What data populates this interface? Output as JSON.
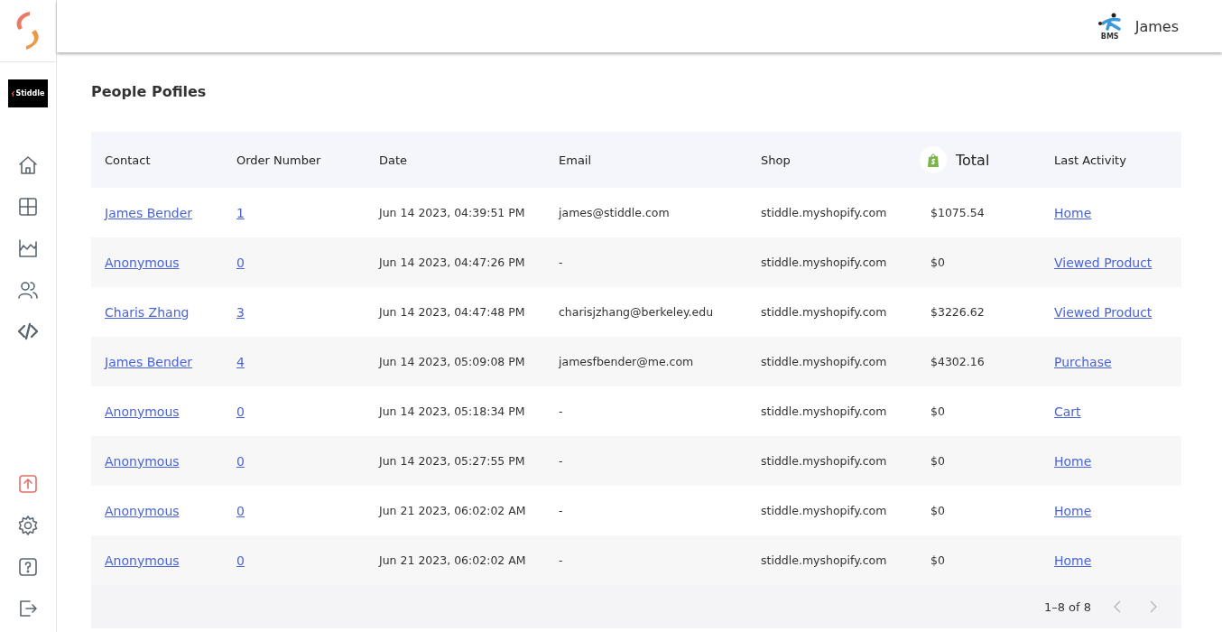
{
  "sidebar": {
    "brand": "Stiddle",
    "items": [
      {
        "kind": "home"
      },
      {
        "kind": "grid"
      },
      {
        "kind": "chart"
      },
      {
        "kind": "users"
      },
      {
        "kind": "code"
      }
    ],
    "bottom_items": [
      {
        "kind": "upload"
      },
      {
        "kind": "settings"
      },
      {
        "kind": "help"
      },
      {
        "kind": "logout"
      }
    ]
  },
  "header": {
    "user_name": "James",
    "logo_text": "BMS"
  },
  "page_title": "People Pofiles",
  "table": {
    "columns": [
      "Contact",
      "Order Number",
      "Date",
      "Email",
      "Shop",
      "Total",
      "Last Activity"
    ],
    "rows": [
      [
        "James Bender",
        "1",
        "Jun 14 2023, 04:39:51 PM",
        "james@stiddle.com",
        "stiddle.myshopify.com",
        "$1075.54",
        "Home"
      ],
      [
        "Anonymous",
        "0",
        "Jun 14 2023, 04:47:26 PM",
        "-",
        "stiddle.myshopify.com",
        "$0",
        "Viewed Product"
      ],
      [
        "Charis Zhang",
        "3",
        "Jun 14 2023, 04:47:48 PM",
        "charisjzhang@berkeley.edu",
        "stiddle.myshopify.com",
        "$3226.62",
        "Viewed Product"
      ],
      [
        "James Bender",
        "4",
        "Jun 14 2023, 05:09:08 PM",
        "jamesfbender@me.com",
        "stiddle.myshopify.com",
        "$4302.16",
        "Purchase"
      ],
      [
        "Anonymous",
        "0",
        "Jun 14 2023, 05:18:34 PM",
        "-",
        "stiddle.myshopify.com",
        "$0",
        "Cart"
      ],
      [
        "Anonymous",
        "0",
        "Jun 14 2023, 05:27:55 PM",
        "-",
        "stiddle.myshopify.com",
        "$0",
        "Home"
      ],
      [
        "Anonymous",
        "0",
        "Jun 21 2023, 06:02:02 AM",
        "-",
        "stiddle.myshopify.com",
        "$0",
        "Home"
      ],
      [
        "Anonymous",
        "0",
        "Jun 21 2023, 06:02:02 AM",
        "-",
        "stiddle.myshopify.com",
        "$0",
        "Home"
      ]
    ],
    "pagination": {
      "range": "1–8 of 8",
      "prev_disabled": true,
      "next_disabled": true
    }
  }
}
